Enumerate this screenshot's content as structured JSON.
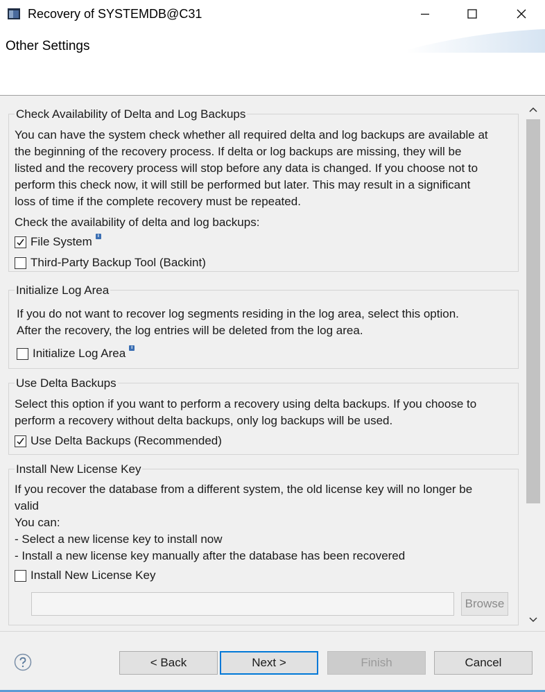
{
  "window": {
    "title": "Recovery of SYSTEMDB@C31",
    "icons": {
      "app": "app-window-icon",
      "minimize": "minimize-icon",
      "maximize": "maximize-icon",
      "close": "close-icon"
    }
  },
  "header": {
    "title": "Other Settings"
  },
  "sections": {
    "check_availability": {
      "title": "Check Availability of Delta and Log Backups",
      "description_lines": [
        "You can have the system check whether all required delta and log backups are available at",
        "the beginning of the recovery process. If delta or log backups are missing, they will be",
        "listed and the recovery process will stop before any data is changed. If you choose not to",
        "perform this check now, it will still be performed but later. This may result in a significant",
        "loss of time if the complete recovery must be repeated."
      ],
      "prompt": "Check the availability of delta and log backups:",
      "options": [
        {
          "label": "File System",
          "checked": true,
          "info_icon": true
        },
        {
          "label": "Third-Party Backup Tool (Backint)",
          "checked": false,
          "info_icon": false
        }
      ]
    },
    "initialize_log": {
      "title": "Initialize Log Area",
      "description_lines": [
        "If you do not want to recover log segments residing in the log area, select this option.",
        "After the recovery, the log entries will be deleted from the log area."
      ],
      "option": {
        "label": "Initialize Log Area",
        "checked": false,
        "info_icon": true
      }
    },
    "delta_backups": {
      "title": "Use Delta Backups",
      "description_lines": [
        "Select this option if you want to perform a recovery using delta backups. If you choose to",
        "perform a recovery without delta backups, only log backups will be used."
      ],
      "option": {
        "label": "Use Delta Backups (Recommended)",
        "checked": true
      }
    },
    "license_key": {
      "title": "Install New License Key",
      "description_lines": [
        "If you recover the database from a different system, the old license key will no longer be",
        "valid",
        "You can:",
        "- Select a new license key to install now",
        "- Install a new license key manually after the database has been recovered"
      ],
      "option": {
        "label": "Install New License Key",
        "checked": false
      },
      "path_value": "",
      "browse_label": "Browse"
    }
  },
  "footer": {
    "help_icon": "help-icon",
    "back_label": "< Back",
    "next_label": "Next >",
    "finish_label": "Finish",
    "cancel_label": "Cancel"
  },
  "colors": {
    "accent": "#0078d7",
    "content_bg": "#f0f0f0",
    "info": "#3b6fb3"
  }
}
